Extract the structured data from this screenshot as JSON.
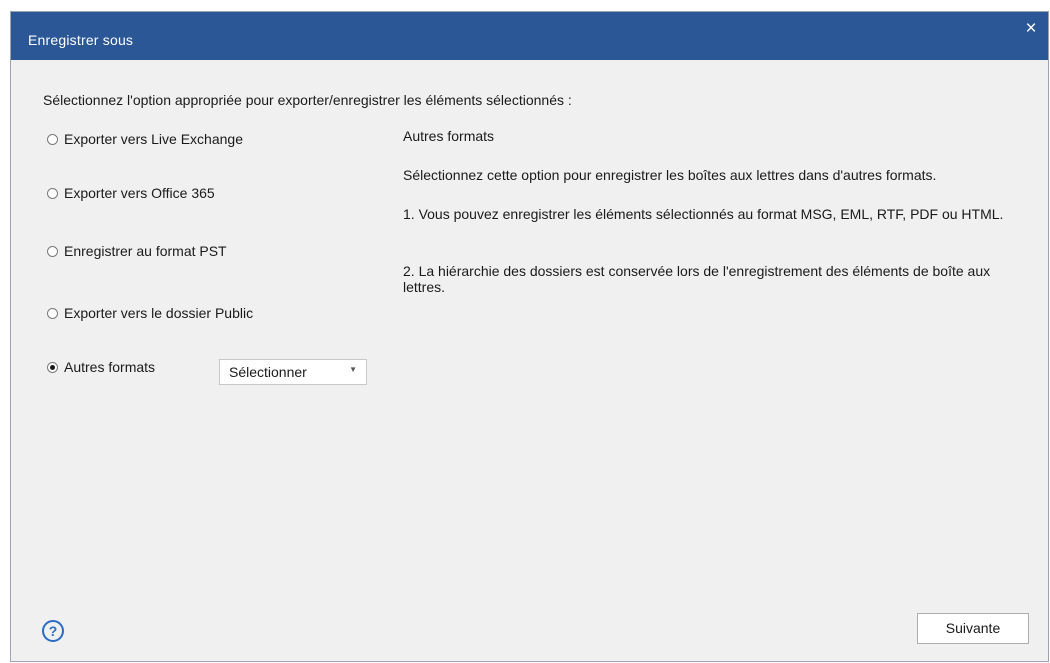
{
  "dialog": {
    "title": "Enregistrer sous",
    "close_glyph": "×",
    "prompt": "Sélectionnez l'option appropriée pour exporter/enregistrer les éléments sélectionnés :"
  },
  "options": [
    {
      "label": "Exporter vers Live Exchange",
      "selected": false
    },
    {
      "label": "Exporter vers Office 365",
      "selected": false
    },
    {
      "label": "Enregistrer au format PST",
      "selected": false
    },
    {
      "label": "Exporter vers le dossier Public",
      "selected": false
    },
    {
      "label": "Autres formats",
      "selected": true
    }
  ],
  "format_select": {
    "value": "Sélectionner",
    "arrow_icon": "chevron-down-icon"
  },
  "description": {
    "title": "Autres formats",
    "line1": "Sélectionnez cette option pour enregistrer les boîtes aux lettres dans d'autres formats.",
    "line2": "1. Vous pouvez enregistrer les éléments sélectionnés au format MSG, EML, RTF, PDF ou HTML.",
    "line3": "2. La hiérarchie des dossiers est conservée lors de l'enregistrement des éléments de boîte aux lettres."
  },
  "footer": {
    "help_glyph": "?",
    "next_label": "Suivante"
  },
  "colors": {
    "titlebar": "#2b5797",
    "dialog_bg": "#f0f0f0",
    "help_icon": "#2b6cc4"
  }
}
